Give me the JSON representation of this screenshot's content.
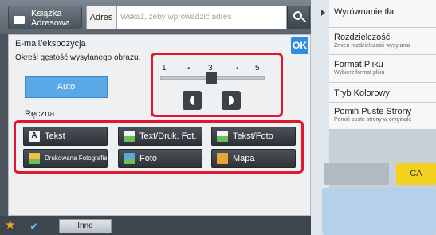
{
  "topbar": {
    "addressbook_label": "Książka Adresowa",
    "address_label": "Adres",
    "address_placeholder": "Wskaż, żeby wprowadzić adres"
  },
  "panel": {
    "title": "E-mail/ekspozycja",
    "subtitle": "Określ gęstość wysyłanego obrazu.",
    "ok_label": "OK",
    "auto_label": "Auto",
    "manual_label": "Ręczna",
    "slider": {
      "min_label": "1",
      "mid_label": "3",
      "max_label": "5",
      "dot": "•",
      "value": 3
    },
    "options": [
      {
        "label": "Tekst",
        "icon": "text-icon"
      },
      {
        "label": "Text/Druk. Fot.",
        "icon": "text-printed-photo-icon"
      },
      {
        "label": "Tekst/Foto",
        "icon": "text-photo-icon"
      },
      {
        "label": "Drukowana Fotografia",
        "icon": "printed-photo-icon"
      },
      {
        "label": "Foto",
        "icon": "photo-icon"
      },
      {
        "label": "Mapa",
        "icon": "map-icon"
      }
    ]
  },
  "right_panel": {
    "items": [
      {
        "title": "Wyrównanie tła",
        "sub": ""
      },
      {
        "title": "Rozdzielczość",
        "sub": "Zmień rozdzielczość wysyłania"
      },
      {
        "title": "Format Pliku",
        "sub": "Wybierz format pliku"
      },
      {
        "title": "Tryb Kolorowy",
        "sub": ""
      },
      {
        "title": "Pomiń Puste Strony",
        "sub": "Pomiń puste strony w oryginale"
      }
    ],
    "ca_label": "CA"
  },
  "bottom_bar": {
    "star": "★",
    "check": "✔",
    "other_label": "Inne"
  },
  "colors": {
    "accent_blue": "#2e8ede",
    "highlight_red": "#e0182f",
    "ca_yellow": "#f4d11e"
  }
}
